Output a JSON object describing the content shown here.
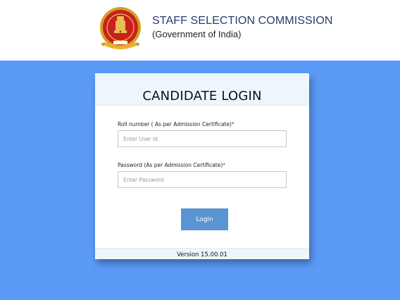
{
  "header": {
    "emblem_icon": "ssc-emblem-icon",
    "org_title": "STAFF SELECTION COMMISSION",
    "org_subtitle": "(Government of India)"
  },
  "login_card": {
    "title": "CANDIDATE LOGIN",
    "roll_label": "Roll number ( As per Admission Certificate)",
    "required_mark": "*",
    "roll_placeholder": "Enter User Id",
    "roll_value": "",
    "password_label": "Password (As per Admission Certificate)",
    "password_placeholder": "Enter Password",
    "password_value": "",
    "login_label": "Login",
    "version": "Version 15.00.01"
  },
  "colors": {
    "background": "#5b9bf8",
    "button": "#5a94d2",
    "header_text": "#2b3a6e",
    "required": "#d9251d"
  }
}
